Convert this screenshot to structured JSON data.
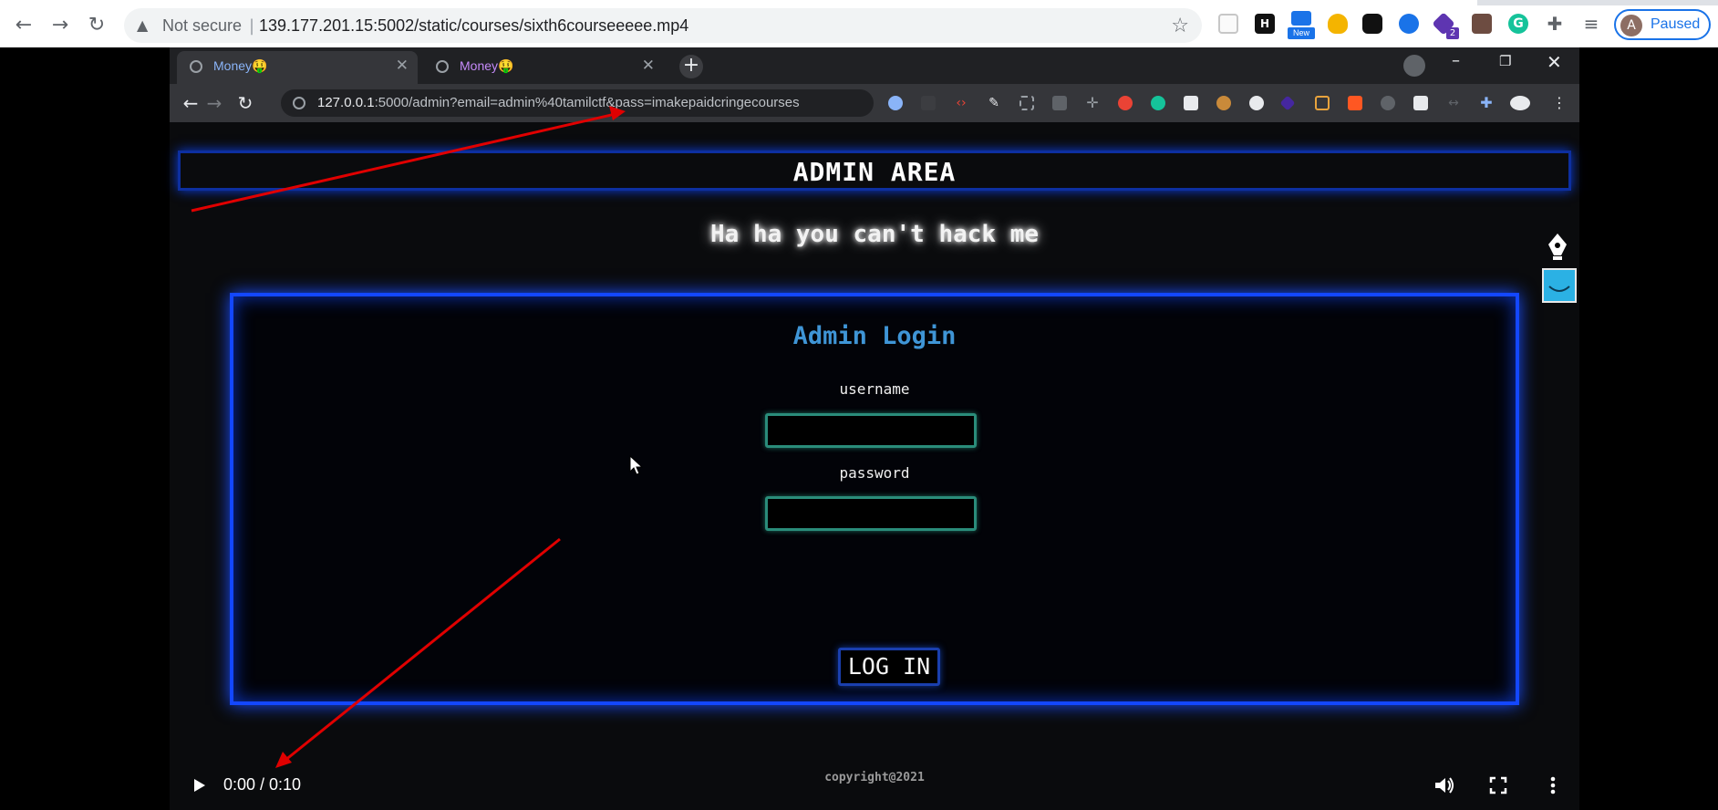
{
  "outer_browser": {
    "nav": {
      "back": "arrow-left",
      "forward": "arrow-right",
      "reload": "reload"
    },
    "security_label": "Not secure",
    "url": "139.177.201.15:5002/static/courses/sixth6courseeeee.mp4",
    "extension_badges": {
      "new": "New",
      "count": "2"
    },
    "profile": {
      "initial": "A",
      "status": "Paused"
    },
    "colors": {
      "accent": "#1a73e8"
    }
  },
  "inner_browser": {
    "tabs": [
      {
        "title": "Money🤑",
        "active": true
      },
      {
        "title": "Money🤑",
        "active": false
      }
    ],
    "url_host": "127.0.0.1",
    "url_rest": ":5000/admin?email=admin%40tamilctf&pass=imakepaidcringecourses"
  },
  "page": {
    "header": "ADMIN AREA",
    "taunt": "Ha ha you can't hack me",
    "login": {
      "title": "Admin Login",
      "username_label": "username",
      "password_label": "password",
      "button": "LOG IN"
    },
    "footer": "copyright@2021"
  },
  "video_controls": {
    "time": "0:00 / 0:10"
  },
  "colors": {
    "neon_blue": "#1347ff",
    "field_border": "#2a8c7a",
    "login_title": "#3f95d6",
    "annotation_arrow": "#e00000"
  }
}
